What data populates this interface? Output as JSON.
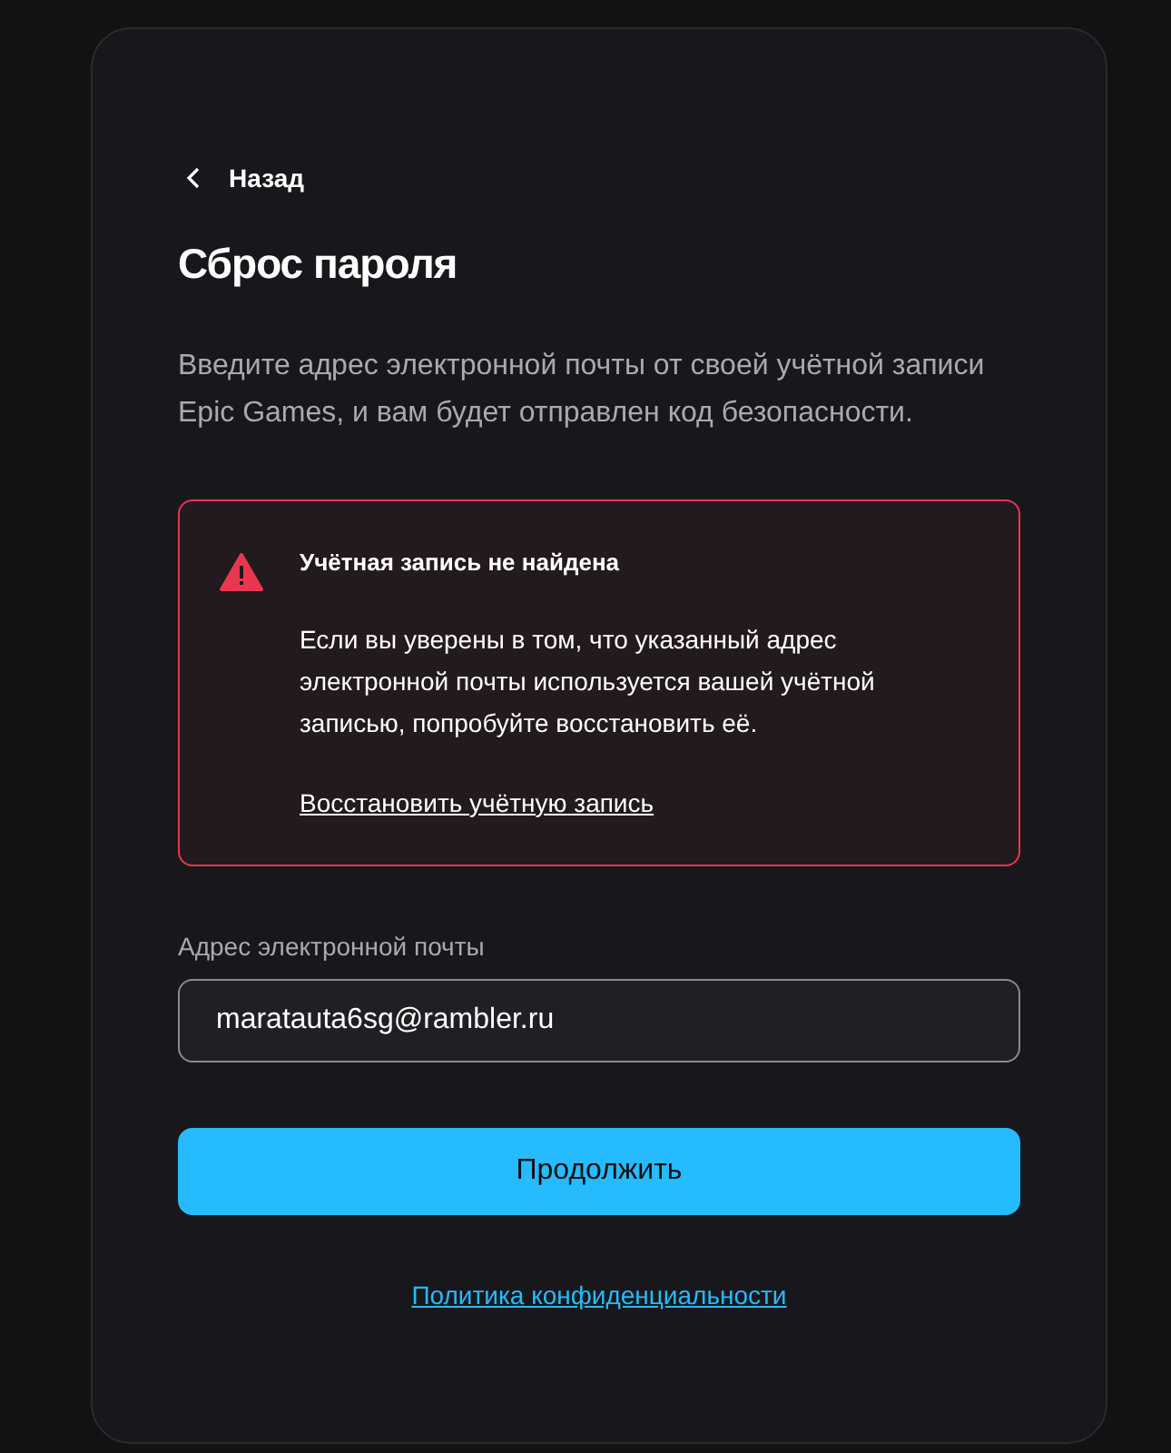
{
  "back_link": {
    "label": "Назад"
  },
  "title": "Сброс пароля",
  "description": "Введите адрес электронной почты от своей учётной записи Epic Games, и вам будет отправлен код безопасности.",
  "alert": {
    "kind": "error",
    "title": "Учётная запись не найдена",
    "message": "Если вы уверены в том, что указанный адрес электронной почты используется вашей учётной записью, попробуйте восстановить её.",
    "link": "Восстановить учётную запись"
  },
  "email_field": {
    "label": "Адрес электронной почты",
    "value": "maratauta6sg@rambler.ru"
  },
  "continue_button": {
    "label": "Продолжить"
  },
  "privacy_link": "Политика конфиденциальности"
}
